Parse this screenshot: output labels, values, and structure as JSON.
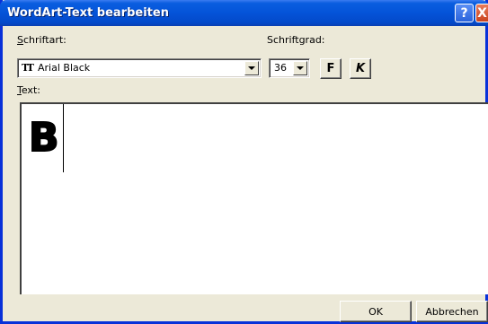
{
  "window": {
    "title": "WordArt-Text bearbeiten",
    "help_glyph": "?",
    "close_glyph": "X"
  },
  "font": {
    "label_mnemonic": "S",
    "label_rest": "chriftart:",
    "value": "Arial Black",
    "icon_glyph": "TT"
  },
  "size": {
    "label_mnemonic": "",
    "label_rest": "Schriftgrad:",
    "value": "36"
  },
  "format": {
    "bold_label": "F",
    "italic_label": "K"
  },
  "text": {
    "label_mnemonic": "T",
    "label_rest": "ext:",
    "content": "B"
  },
  "buttons": {
    "ok_label": "OK",
    "cancel_label": "Abbrechen"
  },
  "colors": {
    "titlebar": "#0453d8",
    "dialog_bg": "#ece9d8",
    "close": "#c9431e"
  },
  "icons": [
    "help-icon",
    "close-icon",
    "truetype-icon",
    "chevron-down-icon"
  ]
}
